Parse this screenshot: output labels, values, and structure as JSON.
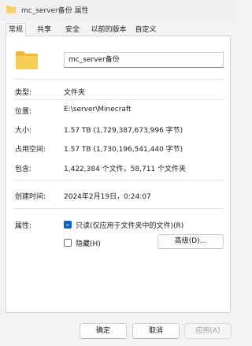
{
  "window": {
    "title": "mc_server备份 属性",
    "icon": "folder-icon"
  },
  "tabs": [
    {
      "label": "常规",
      "active": true
    },
    {
      "label": "共享",
      "active": false
    },
    {
      "label": "安全",
      "active": false
    },
    {
      "label": "以前的版本",
      "active": false
    },
    {
      "label": "自定义",
      "active": false
    }
  ],
  "general": {
    "name_value": "mc_server备份",
    "type_label": "类型:",
    "type_value": "文件夹",
    "location_label": "位置:",
    "location_value": "E:\\server\\Minecraft",
    "size_label": "大小:",
    "size_value": "1.57 TB (1,729,387,673,996 字节)",
    "size_on_disk_label": "占用空间:",
    "size_on_disk_value": "1.57 TB (1,730,196,541,440 字节)",
    "contains_label": "包含:",
    "contains_value": "1,422,384 个文件，58,711 个文件夹",
    "created_label": "创建时间:",
    "created_value": "2024年2月19日，0:24:07",
    "attributes_label": "属性:",
    "readonly_label": "只读(仅应用于文件夹中的文件)(R)",
    "readonly_state": "indeterminate",
    "hidden_label": "隐藏(H)",
    "hidden_state": "unchecked",
    "advanced_label": "高级(D)..."
  },
  "buttons": {
    "ok": "确定",
    "cancel": "取消",
    "apply": "应用(A)"
  },
  "colors": {
    "accent": "#0a64c8",
    "folder": "#f6c54a",
    "window_bg": "#f3f3f3",
    "panel_bg": "#ffffff"
  }
}
